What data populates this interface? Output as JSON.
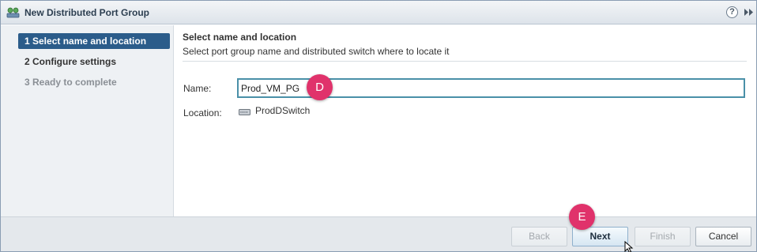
{
  "window": {
    "title": "New Distributed Port Group",
    "help_glyph": "?",
    "icons": {
      "title": "distributed-port-group-icon",
      "help": "help-icon",
      "expand": "double-chevron-right-icon"
    }
  },
  "steps": [
    {
      "label": "1  Select name and location",
      "state": "active"
    },
    {
      "label": "2  Configure settings",
      "state": "normal"
    },
    {
      "label": "3  Ready to complete",
      "state": "disabled"
    }
  ],
  "content": {
    "title": "Select name and location",
    "description": "Select port group name and distributed switch where to locate it",
    "name_label": "Name:",
    "name_value": "Prod_VM_PG",
    "location_label": "Location:",
    "location_value": "ProdDSwitch"
  },
  "annotations": {
    "d": "D",
    "e": "E",
    "color": "#e0326b"
  },
  "buttons": {
    "back": "Back",
    "next": "Next",
    "finish": "Finish",
    "cancel": "Cancel"
  },
  "colors": {
    "active_step": "#2b5c8a",
    "input_border": "#4a90a8",
    "footer": "#e4e8ec"
  }
}
